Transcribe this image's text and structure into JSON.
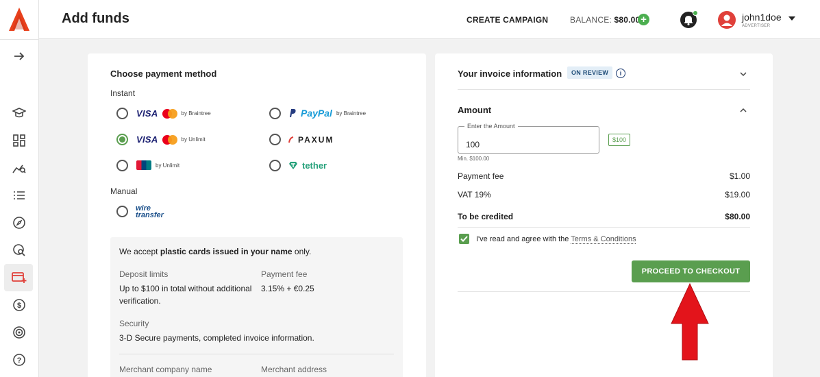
{
  "header": {
    "title": "Add funds",
    "create_campaign": "CREATE CAMPAIGN",
    "balance_label": "BALANCE:",
    "balance_value": "$80.00",
    "username": "john1doe",
    "role": "ADVERTISER"
  },
  "payment": {
    "title": "Choose payment method",
    "instant_label": "Instant",
    "manual_label": "Manual",
    "methods": [
      {
        "by": "by Braintree",
        "selected": false
      },
      {
        "brand": "PayPal",
        "by": "by Braintree",
        "selected": false
      },
      {
        "by": "by Unlimit",
        "selected": true
      },
      {
        "brand": "PAXUM",
        "selected": false
      },
      {
        "by": "by Unlimit",
        "selected": false
      },
      {
        "brand": "tether",
        "selected": false
      }
    ],
    "visa_text": "VISA",
    "wire_line1": "wire",
    "wire_line2": "transfer"
  },
  "info": {
    "accept_prefix": "We accept ",
    "accept_bold": "plastic cards issued in your name",
    "accept_suffix": " only.",
    "deposit_label": "Deposit limits",
    "deposit_value": "Up to $100 in total without additional verification.",
    "fee_label": "Payment fee",
    "fee_value": "3.15% + €0.25",
    "security_label": "Security",
    "security_value": "3-D Secure payments, completed invoice information.",
    "merchant_name_label": "Merchant company name",
    "merchant_address_label": "Merchant address"
  },
  "invoice": {
    "title": "Your invoice information",
    "status": "ON REVIEW",
    "amount_title": "Amount",
    "amount_legend": "Enter the Amount",
    "amount_value": "100",
    "quick_amount": "$100",
    "min_note": "Min. $100.00",
    "payment_fee_label": "Payment fee",
    "payment_fee_value": "$1.00",
    "vat_label": "VAT 19%",
    "vat_value": "$19.00",
    "credited_label": "To be credited",
    "credited_value": "$80.00",
    "agree_text": "I've read and agree with the ",
    "terms_link": "Terms & Conditions",
    "checkout_button": "PROCEED TO CHECKOUT"
  },
  "colors": {
    "accent_green": "#5a9e4f",
    "logo_orange": "#e8401c",
    "arrow_red": "#e3141b"
  }
}
